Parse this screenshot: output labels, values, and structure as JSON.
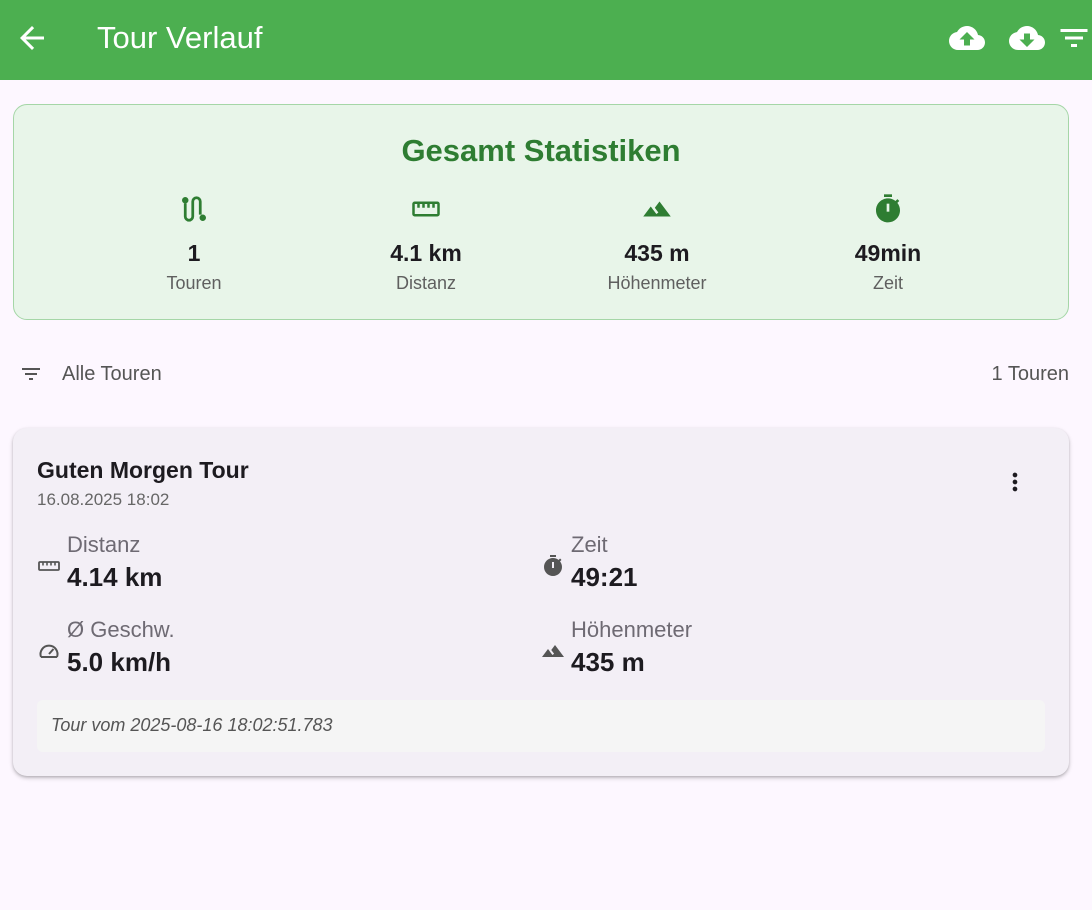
{
  "appbar": {
    "title": "Tour Verlauf",
    "back_icon": "arrow-left-icon",
    "actions": [
      "cloud-upload-icon",
      "cloud-download-icon",
      "filter-icon"
    ],
    "color": "#4caf50"
  },
  "stats": {
    "title": "Gesamt Statistiken",
    "items": [
      {
        "icon": "route-icon",
        "value": "1",
        "label": "Touren"
      },
      {
        "icon": "ruler-icon",
        "value": "4.1 km",
        "label": "Distanz"
      },
      {
        "icon": "mountain-icon",
        "value": "435 m",
        "label": "Höhenmeter"
      },
      {
        "icon": "stopwatch-icon",
        "value": "49min",
        "label": "Zeit"
      }
    ],
    "accent": "#2e7d32"
  },
  "filter": {
    "label": "Alle Touren",
    "count": "1 Touren"
  },
  "tours": [
    {
      "title": "Guten Morgen Tour",
      "date": "16.08.2025 18:02",
      "metrics": {
        "distance": {
          "label": "Distanz",
          "value": "4.14 km",
          "icon": "ruler-icon"
        },
        "time": {
          "label": "Zeit",
          "value": "49:21",
          "icon": "stopwatch-icon"
        },
        "speed": {
          "label": "Ø Geschw.",
          "value": "5.0 km/h",
          "icon": "speedometer-icon"
        },
        "elevation": {
          "label": "Höhenmeter",
          "value": "435 m",
          "icon": "mountain-icon"
        }
      },
      "note": "Tour vom 2025-08-16 18:02:51.783"
    }
  ]
}
